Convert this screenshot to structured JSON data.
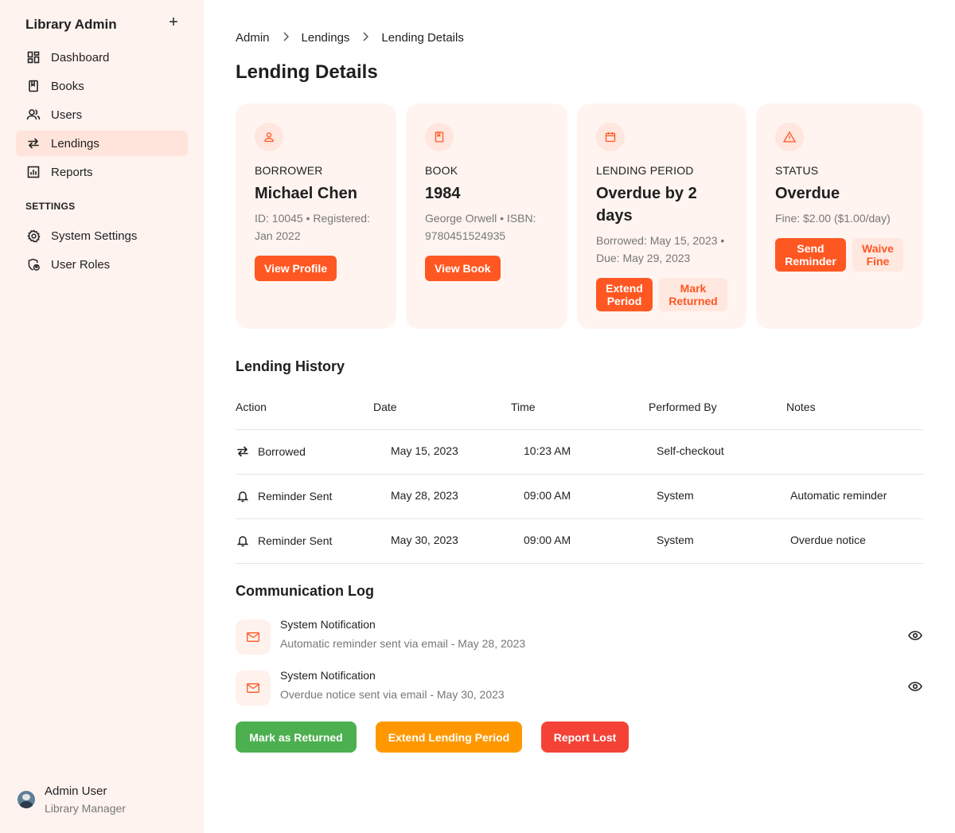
{
  "sidebar": {
    "brand": "Library Admin",
    "add_label": "+",
    "items": [
      {
        "label": "Dashboard",
        "icon": "dashboard-icon"
      },
      {
        "label": "Books",
        "icon": "book-icon"
      },
      {
        "label": "Users",
        "icon": "users-icon"
      },
      {
        "label": "Lendings",
        "icon": "swap-icon",
        "active": true
      },
      {
        "label": "Reports",
        "icon": "chart-icon"
      }
    ],
    "settings_label": "SETTINGS",
    "settings_items": [
      {
        "label": "System Settings",
        "icon": "gear-icon"
      },
      {
        "label": "User Roles",
        "icon": "shield-user-icon"
      }
    ],
    "user": {
      "name": "Admin User",
      "role": "Library Manager"
    }
  },
  "breadcrumb": [
    "Admin",
    "Lendings",
    "Lending Details"
  ],
  "page_title": "Lending Details",
  "cards": {
    "borrower": {
      "label": "BORROWER",
      "value": "Michael Chen",
      "sub": "ID: 10045 • Registered: Jan 2022",
      "button": "View Profile"
    },
    "book": {
      "label": "BOOK",
      "value": "1984",
      "sub": "George Orwell • ISBN: 9780451524935",
      "button": "View Book"
    },
    "period": {
      "label": "LENDING PERIOD",
      "value": "Overdue by 2 days",
      "sub": "Borrowed: May 15, 2023 • Due: May 29, 2023",
      "button_primary": "Extend Period",
      "button_secondary": "Mark Returned"
    },
    "status": {
      "label": "STATUS",
      "value": "Overdue",
      "sub": "Fine: $2.00 ($1.00/day)",
      "button_primary": "Send Reminder",
      "button_secondary": "Waive Fine"
    }
  },
  "history": {
    "title": "Lending History",
    "columns": [
      "Action",
      "Date",
      "Time",
      "Performed By",
      "Notes"
    ],
    "rows": [
      {
        "action": "Borrowed",
        "icon": "swap-icon",
        "date": "May 15, 2023",
        "time": "10:23 AM",
        "by": "Self-checkout",
        "notes": ""
      },
      {
        "action": "Reminder Sent",
        "icon": "bell-icon",
        "date": "May 28, 2023",
        "time": "09:00 AM",
        "by": "System",
        "notes": "Automatic reminder"
      },
      {
        "action": "Reminder Sent",
        "icon": "bell-icon",
        "date": "May 30, 2023",
        "time": "09:00 AM",
        "by": "System",
        "notes": "Overdue notice"
      }
    ]
  },
  "communication": {
    "title": "Communication Log",
    "items": [
      {
        "title": "System Notification",
        "desc": "Automatic reminder sent via email - May 28, 2023"
      },
      {
        "title": "System Notification",
        "desc": "Overdue notice sent via email - May 30, 2023"
      }
    ]
  },
  "actions": {
    "mark_returned": "Mark as Returned",
    "extend": "Extend Lending Period",
    "report_lost": "Report Lost"
  },
  "colors": {
    "accent": "#ff5722",
    "green": "#4caf50",
    "orange": "#ff9800",
    "red": "#f44336",
    "sidebar_bg": "#fff3f0",
    "card_bg": "#fff4f0"
  }
}
